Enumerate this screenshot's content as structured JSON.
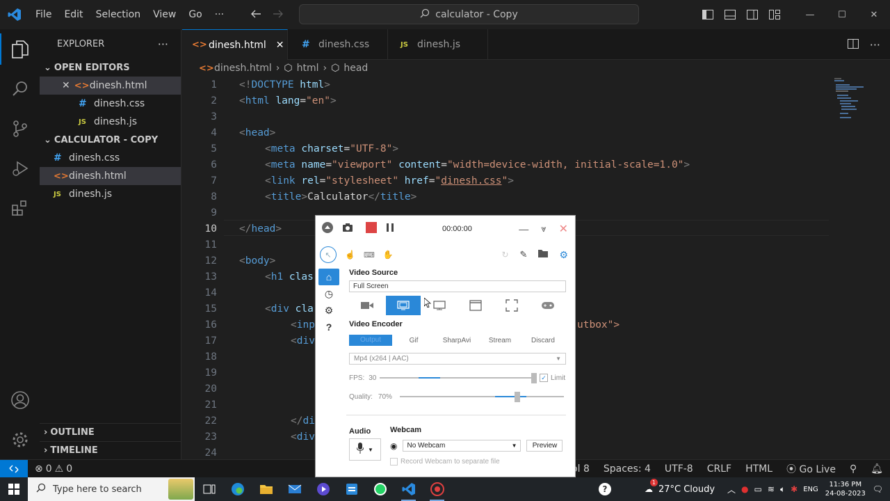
{
  "titlebar": {
    "menu": [
      "File",
      "Edit",
      "Selection",
      "View",
      "Go",
      "···"
    ],
    "search": "calculator - Copy"
  },
  "explorer": {
    "title": "EXPLORER",
    "more": "···",
    "open_editors_label": "OPEN EDITORS",
    "open_editors": [
      {
        "name": "dinesh.html",
        "type": "html"
      },
      {
        "name": "dinesh.css",
        "type": "css"
      },
      {
        "name": "dinesh.js",
        "type": "js"
      }
    ],
    "folder_label": "CALCULATOR - COPY",
    "files": [
      {
        "name": "dinesh.css",
        "type": "css"
      },
      {
        "name": "dinesh.html",
        "type": "html"
      },
      {
        "name": "dinesh.js",
        "type": "js"
      }
    ],
    "outline_label": "OUTLINE",
    "timeline_label": "TIMELINE"
  },
  "tabs": [
    {
      "name": "dinesh.html",
      "icon": "<>",
      "active": true
    },
    {
      "name": "dinesh.css",
      "icon": "#",
      "active": false
    },
    {
      "name": "dinesh.js",
      "icon": "JS",
      "active": false
    }
  ],
  "breadcrumb": [
    "dinesh.html",
    "html",
    "head"
  ],
  "editor": {
    "current_line": 10,
    "lines": [
      "1",
      "2",
      "3",
      "4",
      "5",
      "6",
      "7",
      "8",
      "9",
      "10",
      "11",
      "12",
      "13",
      "14",
      "15",
      "16",
      "17",
      "18",
      "19",
      "20",
      "21",
      "22",
      "23",
      "24"
    ]
  },
  "code": {
    "l1": {
      "a": "<!",
      "b": "DOCTYPE",
      "c": " html",
      "d": ">"
    },
    "l2": {
      "a": "<",
      "b": "html",
      "c": " lang",
      "d": "=",
      "e": "\"en\"",
      "f": ">"
    },
    "l4": {
      "a": "<",
      "b": "head",
      "c": ">"
    },
    "l5": {
      "a": "<",
      "b": "meta",
      "c": " charset",
      "d": "=",
      "e": "\"UTF-8\"",
      "f": ">"
    },
    "l6": {
      "a": "<",
      "b": "meta",
      "c": " name",
      "d": "=",
      "e": "\"viewport\"",
      "f": " content",
      "g": "=",
      "h": "\"width=device-width, initial-scale=1.0\"",
      "i": ">"
    },
    "l7": {
      "a": "<",
      "b": "link",
      "c": " rel",
      "d": "=",
      "e": "\"stylesheet\"",
      "f": " href",
      "g": "=",
      "h1": "\"",
      "h": "dinesh.css",
      "h2": "\"",
      "i": ">"
    },
    "l8": {
      "a": "<",
      "b": "title",
      "c": ">",
      "d": "Calculator",
      "e": "</",
      "f": "title",
      "g": ">"
    },
    "l10": {
      "a": "</",
      "b": "head",
      "c": ">"
    },
    "l12": {
      "a": "<",
      "b": "body",
      "c": ">"
    },
    "l13": {
      "a": "<",
      "b": "h1",
      "c": " clas"
    },
    "l15": {
      "a": "<",
      "b": "div",
      "c": " cla"
    },
    "l16": {
      "a": "<",
      "b": "inp",
      "tail": "utbox\">"
    },
    "l17": {
      "a": "<",
      "b": "div"
    },
    "l22": {
      "a": "</",
      "b": "di"
    },
    "l23": {
      "a": "<",
      "b": "div"
    }
  },
  "status": {
    "errors": "0",
    "warnings": "0",
    "col": "Col 8",
    "spaces": "Spaces: 4",
    "encoding": "UTF-8",
    "eol": "CRLF",
    "language": "HTML",
    "golive": "Go Live"
  },
  "capture": {
    "timer": "00:00:00",
    "video_source_label": "Video Source",
    "video_source_value": "Full Screen",
    "video_encoder_label": "Video Encoder",
    "encoder_tabs": [
      "Output",
      "Gif",
      "SharpAvi",
      "Stream",
      "Discard"
    ],
    "encoder_format": "Mp4 (x264 | AAC)",
    "fps_label": "FPS:",
    "fps_value": "30",
    "fps_limit": "Limit",
    "fps_level": 0.32,
    "quality_label": "Quality:",
    "quality_value": "70%",
    "quality_level": 0.7,
    "audio_label": "Audio",
    "webcam_label": "Webcam",
    "webcam_value": "No Webcam",
    "preview_label": "Preview",
    "record_webcam_label": "Record Webcam to separate file"
  },
  "taskbar": {
    "search_placeholder": "Type here to search",
    "weather": "27°C  Cloudy",
    "weather_badge": "1",
    "lang": "ENG",
    "time": "11:36 PM",
    "date": "24-08-2023"
  },
  "colors": {
    "accent": "#0078d4",
    "capture_accent": "#2a88d8",
    "tag": "#569cd6",
    "attr": "#9cdcfe",
    "string": "#ce9178"
  }
}
